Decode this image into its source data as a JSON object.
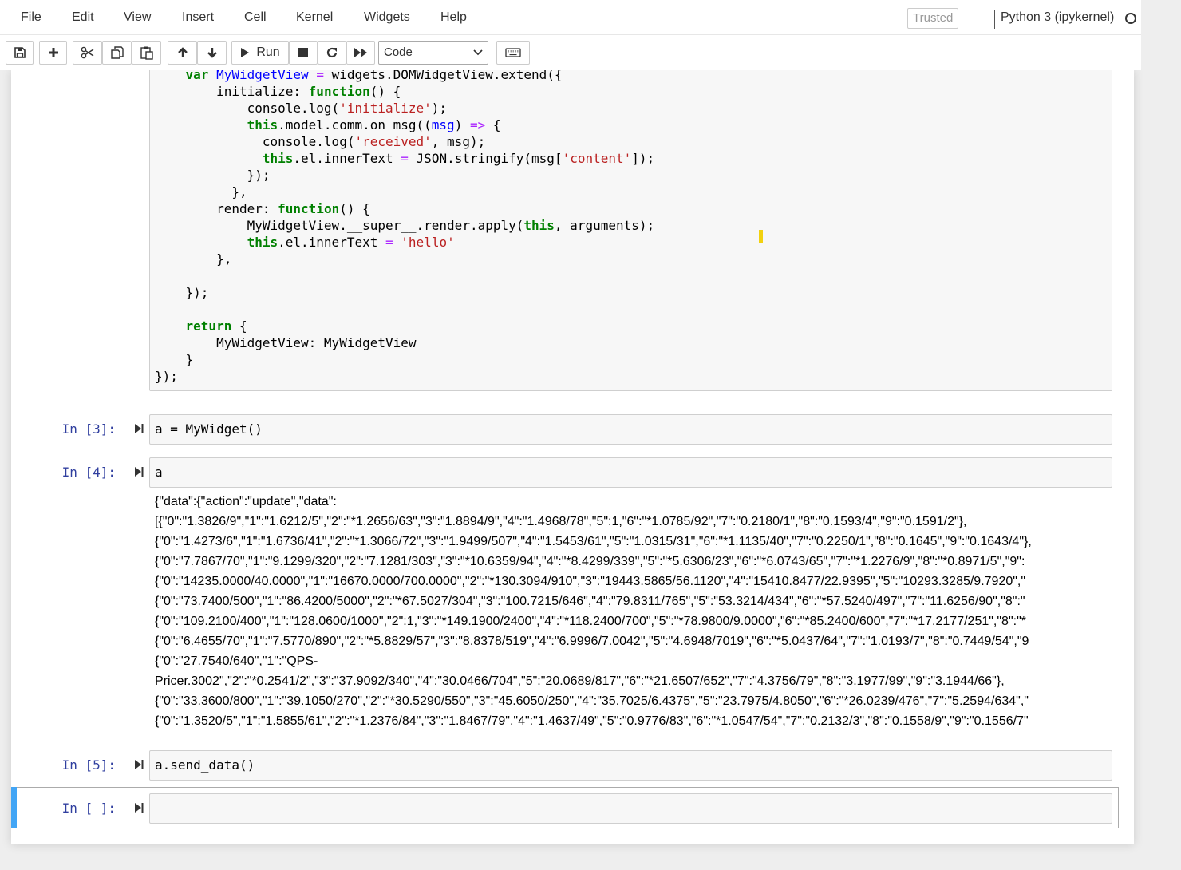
{
  "menubar": {
    "items": [
      "File",
      "Edit",
      "View",
      "Insert",
      "Cell",
      "Kernel",
      "Widgets",
      "Help"
    ],
    "trusted": "Trusted",
    "kernel": "Python 3 (ipykernel)"
  },
  "toolbar": {
    "run_label": "Run",
    "cell_type": "Code",
    "buttons": [
      "save-icon",
      "plus-icon",
      "scissors-icon",
      "copy-icon",
      "paste-icon",
      "arrow-up-icon",
      "arrow-down-icon",
      "play-icon",
      "stop-icon",
      "restart-icon",
      "fast-forward-icon",
      "keyboard-icon"
    ]
  },
  "cells": {
    "c3": {
      "prompt": "In [3]:",
      "code": "a = MyWidget()"
    },
    "c4": {
      "prompt": "In [4]:",
      "code": "a",
      "output": [
        "{\"data\":{\"action\":\"update\",\"data\":",
        "[{\"0\":\"1.3826/9\",\"1\":\"1.6212/5\",\"2\":\"*1.2656/63\",\"3\":\"1.8894/9\",\"4\":\"1.4968/78\",\"5\":1,\"6\":\"*1.0785/92\",\"7\":\"0.2180/1\",\"8\":\"0.1593/4\",\"9\":\"0.1591/2\"},",
        "{\"0\":\"1.4273/6\",\"1\":\"1.6736/41\",\"2\":\"*1.3066/72\",\"3\":\"1.9499/507\",\"4\":\"1.5453/61\",\"5\":\"1.0315/31\",\"6\":\"*1.1135/40\",\"7\":\"0.2250/1\",\"8\":\"0.1645\",\"9\":\"0.1643/4\"},",
        "{\"0\":\"7.7867/70\",\"1\":\"9.1299/320\",\"2\":\"7.1281/303\",\"3\":\"*10.6359/94\",\"4\":\"*8.4299/339\",\"5\":\"*5.6306/23\",\"6\":\"*6.0743/65\",\"7\":\"*1.2276/9\",\"8\":\"*0.8971/5\",\"9\":",
        "{\"0\":\"14235.0000/40.0000\",\"1\":\"16670.0000/700.0000\",\"2\":\"*130.3094/910\",\"3\":\"19443.5865/56.1120\",\"4\":\"15410.8477/22.9395\",\"5\":\"10293.3285/9.7920\",\"",
        "{\"0\":\"73.7400/500\",\"1\":\"86.4200/5000\",\"2\":\"*67.5027/304\",\"3\":\"100.7215/646\",\"4\":\"79.8311/765\",\"5\":\"53.3214/434\",\"6\":\"*57.5240/497\",\"7\":\"11.6256/90\",\"8\":\"",
        "{\"0\":\"109.2100/400\",\"1\":\"128.0600/1000\",\"2\":1,\"3\":\"*149.1900/2400\",\"4\":\"*118.2400/700\",\"5\":\"*78.9800/9.0000\",\"6\":\"*85.2400/600\",\"7\":\"*17.2177/251\",\"8\":\"*",
        "{\"0\":\"6.4655/70\",\"1\":\"7.5770/890\",\"2\":\"*5.8829/57\",\"3\":\"8.8378/519\",\"4\":\"6.9996/7.0042\",\"5\":\"4.6948/7019\",\"6\":\"*5.0437/64\",\"7\":\"1.0193/7\",\"8\":\"0.7449/54\",\"9",
        "{\"0\":\"27.7540/640\",\"1\":\"QPS-",
        "Pricer.3002\",\"2\":\"*0.2541/2\",\"3\":\"37.9092/340\",\"4\":\"30.0466/704\",\"5\":\"20.0689/817\",\"6\":\"*21.6507/652\",\"7\":\"4.3756/79\",\"8\":\"3.1977/99\",\"9\":\"3.1944/66\"},",
        "{\"0\":\"33.3600/800\",\"1\":\"39.1050/270\",\"2\":\"*30.5290/550\",\"3\":\"45.6050/250\",\"4\":\"35.7025/6.4375\",\"5\":\"23.7975/4.8050\",\"6\":\"*26.0239/476\",\"7\":\"5.2594/634\",\"",
        "{\"0\":\"1.3520/5\",\"1\":\"1.5855/61\",\"2\":\"*1.2376/84\",\"3\":\"1.8467/79\",\"4\":\"1.4637/49\",\"5\":\"0.9776/83\",\"6\":\"*1.0547/54\",\"7\":\"0.2132/3\",\"8\":\"0.1558/9\",\"9\":\"0.1556/7\""
      ]
    },
    "c5": {
      "prompt": "In [5]:",
      "code": "a.send_data()"
    },
    "c6": {
      "prompt": "In [ ]:",
      "code": ""
    }
  },
  "js_cell": {
    "tokens": [
      "var",
      "MyWidgetView",
      "=",
      "widgets.DOMWidgetView.extend({",
      "initialize:",
      "function",
      "() {",
      "console.log(",
      "'initialize'",
      ");",
      "this",
      ".model.comm.on_msg((",
      "msg",
      ")",
      "=>",
      "{",
      "console.log(",
      "'received'",
      ", msg);",
      "this",
      ".el.innerText",
      "=",
      "JSON.stringify(msg[",
      "'content'",
      "]);",
      "});",
      "},",
      "render:",
      "function",
      "() {",
      "MyWidgetView.__super__.render.apply(",
      "this",
      ", arguments);",
      "this",
      ".el.innerText",
      "=",
      "'hello'",
      "},",
      "});",
      "return",
      "{",
      "MyWidgetView: MyWidgetView",
      "}",
      "});"
    ]
  }
}
